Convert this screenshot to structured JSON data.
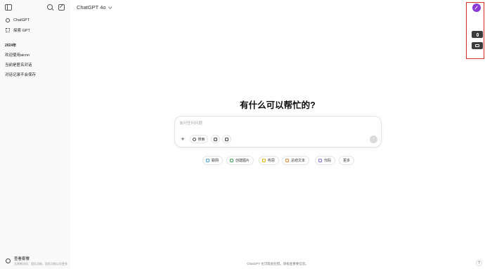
{
  "sidebar": {
    "nav": [
      {
        "label": "ChatGPT",
        "icon": "openai-logo-icon"
      },
      {
        "label": "探索 GPT",
        "icon": "grid-icon"
      }
    ],
    "section_label": "2024年",
    "history": [
      "欢迎使用aicnn",
      "当前是匿名对话",
      "对话记录不会保存"
    ],
    "upgrade": {
      "title": "查看套餐",
      "subtitle": "无限制访问、团队功能，团队功能以及更多"
    }
  },
  "header": {
    "model": "ChatGPT 4o"
  },
  "main": {
    "greeting": "有什么可以帮忙的?",
    "composer": {
      "placeholder": "询问任何问题",
      "search_label": "搜索",
      "plus": "+",
      "send": "↑"
    },
    "chips": [
      {
        "label": "联网",
        "color": "#4aa3df"
      },
      {
        "label": "创建图片",
        "color": "#3aa655"
      },
      {
        "label": "构思",
        "color": "#e8b400"
      },
      {
        "label": "总结文本",
        "color": "#ef8a3c"
      },
      {
        "label": "代码",
        "color": "#7a6cf0"
      },
      {
        "label": "更多",
        "color": ""
      }
    ]
  },
  "footer": {
    "note": "ChatGPT 也可能会犯错。请核查重要信息。",
    "help": "?"
  },
  "colors": {
    "highlight": "#d93025",
    "avatar": "#8a3ad6"
  }
}
